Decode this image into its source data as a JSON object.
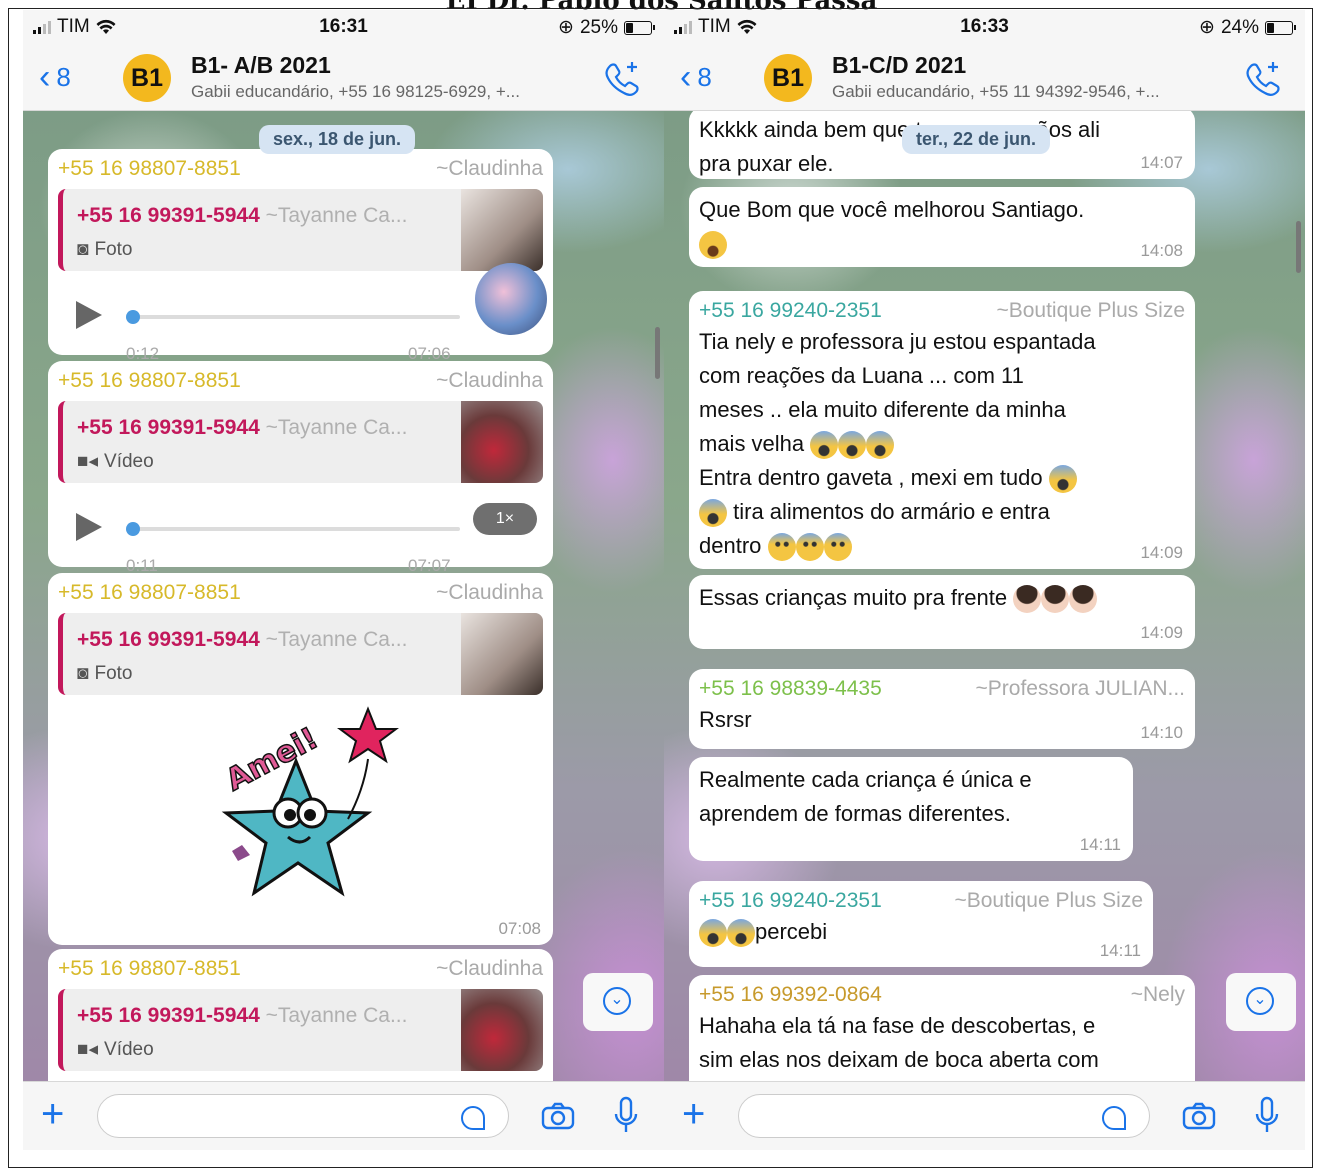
{
  "document_title": "EI Dr. Pablo dos Santos Passa",
  "icons": [
    "signal-icon",
    "wifi-icon",
    "battery-icon",
    "back-chevron-icon",
    "call-add-icon",
    "plus-icon",
    "sticker-icon",
    "camera-icon",
    "mic-icon",
    "scroll-down-icon",
    "photo-icon",
    "video-icon",
    "play-icon"
  ],
  "left": {
    "status": {
      "carrier": "TIM",
      "time": "16:31",
      "battery": "25%"
    },
    "header": {
      "back_count": "8",
      "avatar": "B1",
      "title": "B1- A/B 2021",
      "subtitle": "Gabii educandário, +55 16 98125-6929, +..."
    },
    "date_pill": "sex., 18 de jun.",
    "messages": [
      {
        "sender": "+55 16 98807-8851",
        "name": "~Claudinha",
        "quote_sender": "+55 16 99391-5944",
        "quote_name": "~Tayanne Ca...",
        "quote_type": "Foto",
        "duration": "0:12",
        "time": "07:06"
      },
      {
        "sender": "+55 16 98807-8851",
        "name": "~Claudinha",
        "quote_sender": "+55 16 99391-5944",
        "quote_name": "~Tayanne Ca...",
        "quote_type": "Vídeo",
        "duration": "0:11",
        "time": "07:07",
        "speed": "1×"
      },
      {
        "sender": "+55 16 98807-8851",
        "name": "~Claudinha",
        "quote_sender": "+55 16 99391-5944",
        "quote_name": "~Tayanne Ca...",
        "quote_type": "Foto",
        "sticker": "Amei!",
        "time": "07:08"
      },
      {
        "sender": "+55 16 98807-8851",
        "name": "~Claudinha",
        "quote_sender": "+55 16 99391-5944",
        "quote_name": "~Tayanne Ca...",
        "quote_type": "Vídeo"
      }
    ]
  },
  "right": {
    "status": {
      "carrier": "TIM",
      "time": "16:33",
      "battery": "24%"
    },
    "header": {
      "back_count": "8",
      "avatar": "B1",
      "title": "B1-C/D 2021",
      "subtitle": "Gabii educandário, +55 11 94392-9546, +..."
    },
    "date_pill": "ter., 22 de jun.",
    "messages": [
      {
        "text_a": "Kkkkk ainda bem que tem umas mãos ali",
        "text_b": "pra puxar ele.",
        "time": "14:07"
      },
      {
        "text_a": "Que Bom que você melhorou Santiago.",
        "time": "14:08"
      },
      {
        "sender": "+55 16 99240-2351",
        "name": "~Boutique Plus Size",
        "lines": [
          "Tia nely  e professora ju estou espantada",
          "com  reações da Luana ... com 11",
          "meses .. ela muito diferente  da minha",
          "mais velha",
          " Entra dentro gaveta ,  mexi em tudo",
          "tira alimentos do armário e entra",
          "dentro"
        ],
        "time": "14:09"
      },
      {
        "text_a": "Essas crianças muito pra frente",
        "time": "14:09"
      },
      {
        "sender": "+55 16 98839-4435",
        "name": "~Professora JULIAN...",
        "text_a": "Rsrsr",
        "time": "14:10"
      },
      {
        "text_a": "Realmente cada criança é única e",
        "text_b": "aprendem de formas diferentes.",
        "time": "14:11"
      },
      {
        "sender": "+55 16 99240-2351",
        "name": "~Boutique Plus Size",
        "text_a": "percebi",
        "time": "14:11"
      },
      {
        "sender": "+55 16 99392-0864",
        "name": "~Nely",
        "text_a": "Hahaha ela tá na fase de descobertas, e",
        "text_b": "sim elas nos deixam de boca aberta com"
      }
    ]
  },
  "colors": {
    "link_blue": "#1a73e8",
    "sender_yellow": "#d7b92a",
    "quote_pink": "#c2185b",
    "sender_green": "#7dc04b",
    "sender_teal": "#3aa7a0",
    "sender_olive": "#c79a2c",
    "avatar_yellow": "#f3b81e"
  }
}
